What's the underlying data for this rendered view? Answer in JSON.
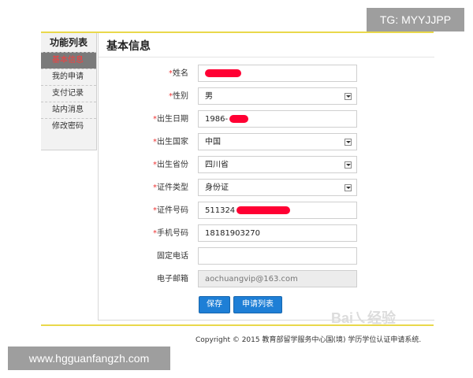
{
  "watermarks": {
    "top": "TG: MYYJJPP",
    "bottom": "www.hgguanfangzh.com",
    "baidu": "Bai㇏经验"
  },
  "sidebar": {
    "heading": "功能列表",
    "items": [
      {
        "label": "基本信息",
        "active": true
      },
      {
        "label": "我的申请"
      },
      {
        "label": "支付记录"
      },
      {
        "label": "站内消息"
      },
      {
        "label": "修改密码"
      }
    ]
  },
  "main": {
    "title": "基本信息",
    "required_mark": "*",
    "form": {
      "name": {
        "label": "姓名",
        "value": ""
      },
      "gender": {
        "label": "性别",
        "value": "男"
      },
      "birth_date": {
        "label": "出生日期",
        "value": "1986-"
      },
      "birth_country": {
        "label": "出生国家",
        "value": "中国"
      },
      "birth_province": {
        "label": "出生省份",
        "value": "四川省"
      },
      "id_type": {
        "label": "证件类型",
        "value": "身份证"
      },
      "id_number": {
        "label": "证件号码",
        "value": "511324"
      },
      "mobile": {
        "label": "手机号码",
        "value": "18181903270"
      },
      "landline": {
        "label": "固定电话",
        "value": ""
      },
      "email": {
        "label": "电子邮箱",
        "value": "aochuangvip@163.com"
      }
    },
    "buttons": {
      "save": "保存",
      "apply_list": "申请列表"
    }
  },
  "footer": {
    "copyright": "Copyright © 2015 教育部留学服务中心国(境) 学历学位认证申请系统."
  },
  "colors": {
    "accent": "#1e7fd6",
    "required": "#e33333",
    "frame_line": "#e9d84b",
    "redaction": "#ff0033"
  }
}
